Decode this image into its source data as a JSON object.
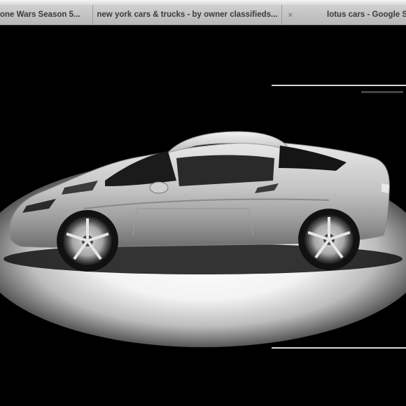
{
  "browser": {
    "tabs": [
      {
        "label": "one Wars Season 5...",
        "active": false,
        "closable": false
      },
      {
        "label": "new york cars & trucks - by owner classifieds...",
        "active": false,
        "closable": false
      },
      {
        "label": "lotus cars - Google Se",
        "active": true,
        "closable": true
      }
    ],
    "close_icon": "×"
  },
  "content": {
    "image_subject": "silver Lotus sports car side view",
    "colors": {
      "background": "#000000",
      "car_body": "#c8c8c8",
      "spotlight": "#ffffff"
    }
  }
}
